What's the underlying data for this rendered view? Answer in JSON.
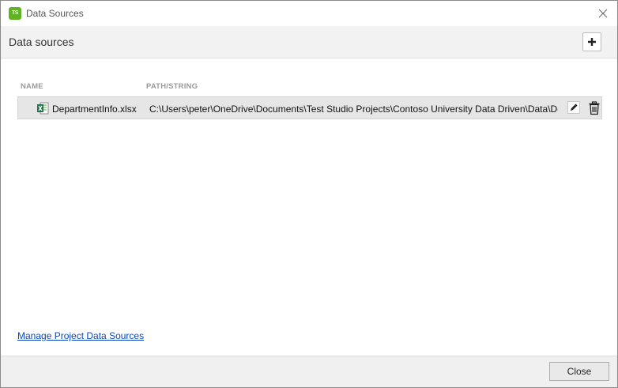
{
  "window": {
    "title": "Data Sources",
    "app_icon_text": "TS",
    "app_icon_color": "#5fb323"
  },
  "header": {
    "title": "Data sources",
    "add_icon": "plus-icon"
  },
  "table": {
    "columns": [
      "NAME",
      "PATH/STRING"
    ],
    "rows": [
      {
        "icon": "excel-file-icon",
        "name": "DepartmentInfo.xlsx",
        "path": "C:\\Users\\peter\\OneDrive\\Documents\\Test Studio Projects\\Contoso University Data Driven\\Data\\DepartmentInfo.xlsx",
        "actions": [
          "pencil-icon",
          "trash-icon"
        ]
      }
    ]
  },
  "links": {
    "manage": "Manage Project Data Sources"
  },
  "footer": {
    "close_label": "Close"
  },
  "colors": {
    "link": "#0645c6",
    "selected_row": "#e6e6e6",
    "header_bg": "#f2f2f2"
  }
}
